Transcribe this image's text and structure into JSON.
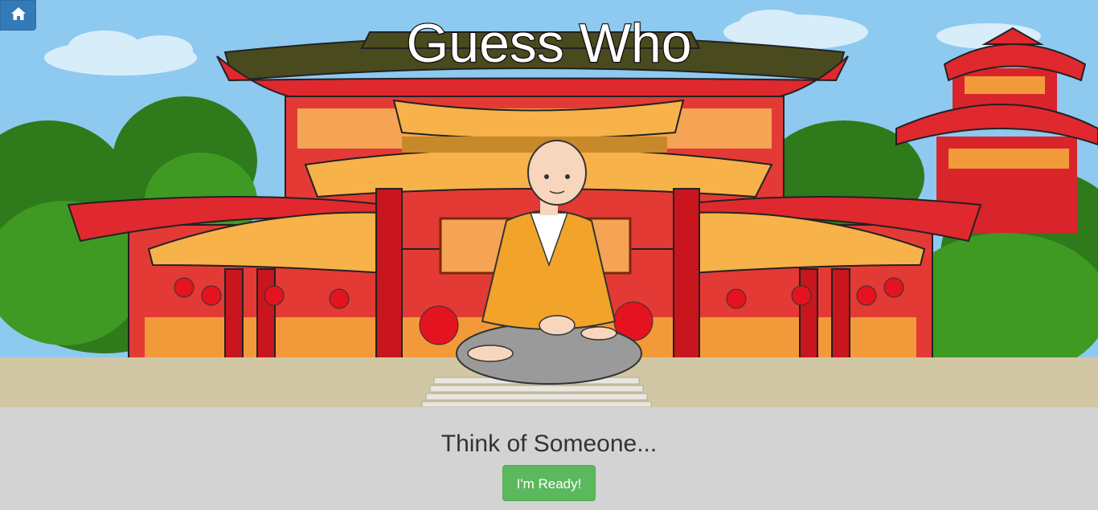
{
  "header": {
    "home_icon": "home-icon",
    "title": "Guess Who"
  },
  "main": {
    "prompt": "Think of Someone...",
    "ready_button_label": "I'm Ready!"
  },
  "colors": {
    "home_button": "#337ab7",
    "ready_button": "#5cb85c",
    "bottom_panel": "#d3d3d3"
  }
}
